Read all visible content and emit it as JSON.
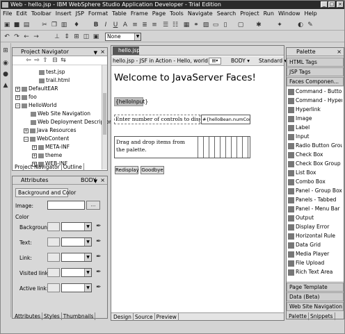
{
  "window": {
    "title": "Web - hello.jsp - IBM WebSphere Studio Application Developer - Trial Edition",
    "minimize": "_",
    "maximize": "□",
    "close": "×"
  },
  "menu": [
    "File",
    "Edit",
    "Toolbar",
    "Insert",
    "JSP",
    "Format",
    "Table",
    "Frame",
    "Page",
    "Tools",
    "Navigate",
    "Search",
    "Project",
    "Run",
    "Window",
    "Help"
  ],
  "toolbar2": {
    "style_select": "None"
  },
  "navigator": {
    "title": "Project Navigator",
    "items": [
      "test.jsp",
      "trail.html",
      "DefaultEAR",
      "foo",
      "HelloWorld",
      "Web Site Navigation",
      "Web Deployment Descriptor",
      "Java Resources",
      "WebContent",
      "META-INF",
      "theme",
      "WEB-INF"
    ],
    "tabs": [
      "Project Navigator",
      "Outline"
    ]
  },
  "attributes": {
    "title": "Attributes",
    "tag": "BODY",
    "tab": "Background and Color",
    "image_label": "Image:",
    "browse": "...",
    "color_group": "Color",
    "rows": [
      "Background:",
      "Text:",
      "Link:",
      "Visited link:",
      "Active link:"
    ],
    "tabs": [
      "Attributes",
      "Styles",
      "Thumbnails"
    ]
  },
  "editor": {
    "tab": "hello.jsp",
    "breadcrumb": "hello.jsp - JSF in Action - Hello, world!",
    "tag": "BODY",
    "mode": "Standard",
    "heading": "Welcome to JavaServer Faces!",
    "input_tag": "{helloInput}",
    "prompt": "Enter number of controls to display:",
    "binding": "#{helloBean.numControls}",
    "drop_text": "Drag and drop items from the palette.",
    "btn_redisplay": "Redisplay",
    "btn_goodbye": "Goodbye",
    "tabs": [
      "Design",
      "Source",
      "Preview"
    ]
  },
  "palette": {
    "title": "Palette",
    "drawers_top": [
      "HTML Tags",
      "JSP Tags",
      "Faces Componen..."
    ],
    "items": [
      "Command - Button",
      "Command - Hyperlink",
      "Hyperlink",
      "Image",
      "Label",
      "Input",
      "Radio Button Group",
      "Check Box",
      "Check Box Group",
      "List Box",
      "Combo Box",
      "Panel - Group Box",
      "Panels - Tabbed",
      "Panel - Menu Bar",
      "Output",
      "Display Error",
      "Horizontal Rule",
      "Data Grid",
      "Media Player",
      "File Upload",
      "Rich Text Area"
    ],
    "drawers_bottom": [
      "Page Template",
      "Data (Beta)",
      "Web Site Navigation"
    ],
    "tabs": [
      "Palette",
      "Snippets"
    ]
  }
}
